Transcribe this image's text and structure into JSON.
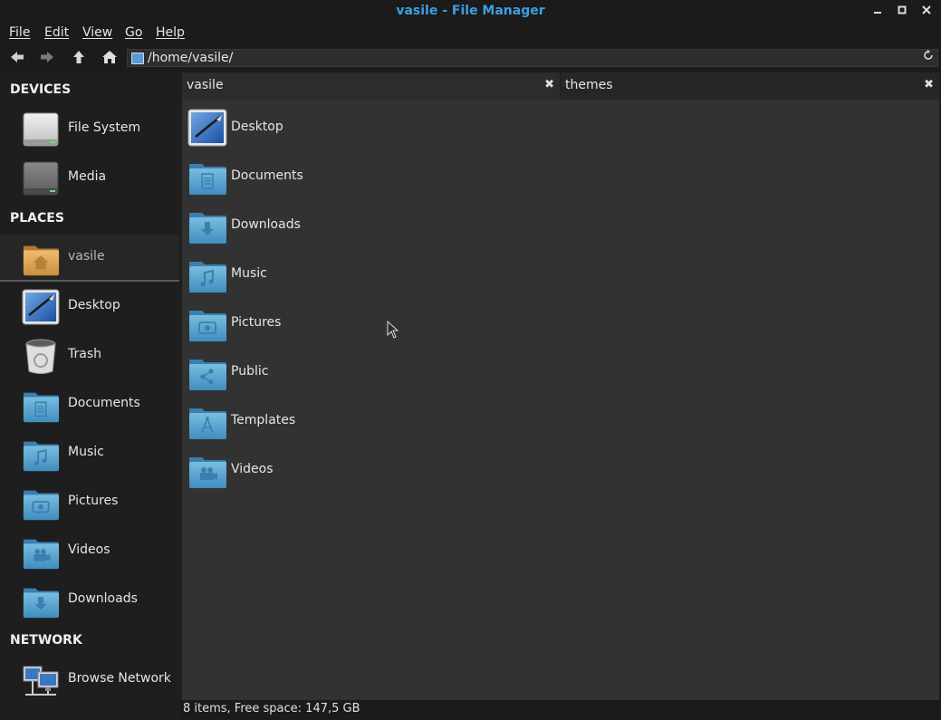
{
  "window": {
    "title": "vasile - File Manager"
  },
  "menu": [
    "File",
    "Edit",
    "View",
    "Go",
    "Help"
  ],
  "toolbar": {
    "back": "back-icon",
    "forward": "forward-icon",
    "up": "up-icon",
    "home": "home-icon",
    "path": "/home/vasile/",
    "reload": "reload-icon"
  },
  "sidebar": {
    "devices_header": "DEVICES",
    "devices": [
      {
        "label": "File System",
        "icon": "drive-icon"
      },
      {
        "label": "Media",
        "icon": "drive-icon"
      }
    ],
    "places_header": "PLACES",
    "places": [
      {
        "label": "vasile",
        "icon": "home-folder-icon",
        "selected": true
      },
      {
        "label": "Desktop",
        "icon": "desktop-icon"
      },
      {
        "label": "Trash",
        "icon": "trash-icon"
      },
      {
        "label": "Documents",
        "icon": "documents-folder-icon"
      },
      {
        "label": "Music",
        "icon": "music-folder-icon"
      },
      {
        "label": "Pictures",
        "icon": "pictures-folder-icon"
      },
      {
        "label": "Videos",
        "icon": "videos-folder-icon"
      },
      {
        "label": "Downloads",
        "icon": "downloads-folder-icon"
      }
    ],
    "network_header": "NETWORK",
    "network": [
      {
        "label": "Browse Network",
        "icon": "network-icon"
      }
    ]
  },
  "tabs": [
    {
      "label": "vasile",
      "close": "✖"
    },
    {
      "label": "themes",
      "close": "✖"
    }
  ],
  "files": [
    {
      "label": "Desktop",
      "icon": "desktop-icon"
    },
    {
      "label": "Documents",
      "icon": "documents-folder-icon"
    },
    {
      "label": "Downloads",
      "icon": "downloads-folder-icon"
    },
    {
      "label": "Music",
      "icon": "music-folder-icon"
    },
    {
      "label": "Pictures",
      "icon": "pictures-folder-icon"
    },
    {
      "label": "Public",
      "icon": "public-folder-icon"
    },
    {
      "label": "Templates",
      "icon": "templates-folder-icon"
    },
    {
      "label": "Videos",
      "icon": "videos-folder-icon"
    }
  ],
  "status": "8 items, Free space: 147,5 GB",
  "colors": {
    "accent": "#3d9fe0",
    "folder": "#5ba5cf",
    "home_folder": "#d8a25a"
  }
}
